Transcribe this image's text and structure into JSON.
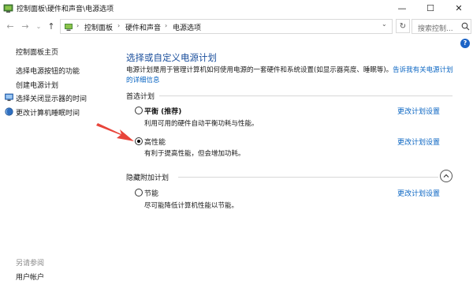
{
  "window": {
    "title": "控制面板\\硬件和声音\\电源选项",
    "minimize": "—",
    "maximize": "☐",
    "close": "✕"
  },
  "nav": {
    "back": "←",
    "forward": "→",
    "dropdown": "⌄",
    "up": "↑"
  },
  "address": {
    "crumbs": [
      "控制面板",
      "硬件和声音",
      "电源选项"
    ],
    "separator": "›",
    "refresh": "↻",
    "search_placeholder": "搜索控制..."
  },
  "help": "?",
  "sidebar": {
    "home": "控制面板主页",
    "items": [
      {
        "label": "选择电源按钮的功能",
        "icon": ""
      },
      {
        "label": "创建电源计划",
        "icon": ""
      },
      {
        "label": "选择关闭显示器的时间",
        "icon": "display-shield-icon"
      },
      {
        "label": "更改计算机睡眠时间",
        "icon": "moon-globe-icon"
      }
    ],
    "see_also": "另请参阅",
    "user_accounts": "用户帐户"
  },
  "main": {
    "heading": "选择或自定义电源计划",
    "description": "电源计划是用于管理计算机如何使用电源的一套硬件和系统设置(如显示器亮度、睡眠等)。",
    "description_link": "告诉我有关电源计划的详细信息",
    "preferred_label": "首选计划",
    "plans": [
      {
        "name": "平衡 (推荐)",
        "desc": "利用可用的硬件自动平衡功耗与性能。",
        "link": "更改计划设置",
        "checked": false
      },
      {
        "name": "高性能",
        "desc": "有利于提高性能，但会增加功耗。",
        "link": "更改计划设置",
        "checked": true
      }
    ],
    "hidden_label": "隐藏附加计划",
    "hidden_plans": [
      {
        "name": "节能",
        "desc": "尽可能降低计算机性能以节能。",
        "link": "更改计划设置",
        "checked": false
      }
    ]
  },
  "colors": {
    "accent": "#0b66c3",
    "heading": "#1b4f9c",
    "arrow": "#e8443a"
  }
}
